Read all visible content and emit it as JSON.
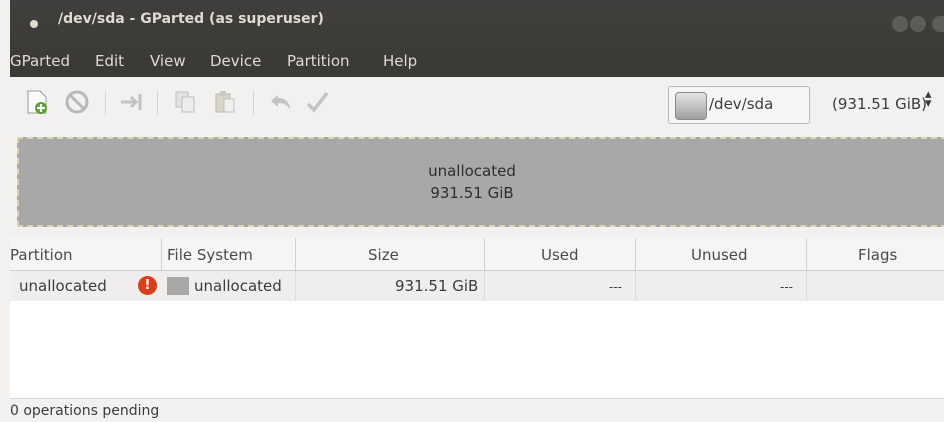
{
  "window": {
    "title": "/dev/sda - GParted (as superuser)"
  },
  "menubar": {
    "items": [
      "GParted",
      "Edit",
      "View",
      "Device",
      "Partition",
      "Help"
    ]
  },
  "toolbar": {
    "icons": [
      "new-partition-icon",
      "delete-icon",
      "resize-move-icon",
      "copy-icon",
      "paste-icon",
      "undo-icon",
      "apply-icon"
    ]
  },
  "device": {
    "name": "/dev/sda",
    "size": "(931.51 GiB)"
  },
  "diskmap": {
    "label": "unallocated",
    "size": "931.51 GiB"
  },
  "table": {
    "headers": [
      "Partition",
      "File System",
      "Size",
      "Used",
      "Unused",
      "Flags"
    ],
    "rows": [
      {
        "partition": "unallocated",
        "filesystem": "unallocated",
        "size": "931.51 GiB",
        "used": "---",
        "unused": "---",
        "flags": ""
      }
    ]
  },
  "status": {
    "text": "0 operations pending"
  },
  "colors": {
    "titlebar": "#3a3935",
    "unallocated": "#a8a8a8",
    "warning": "#d93f1b"
  }
}
